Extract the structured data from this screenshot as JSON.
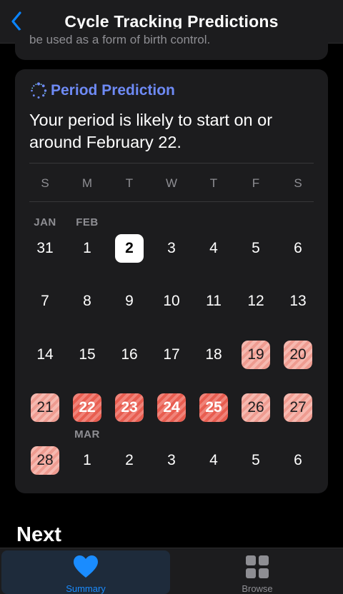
{
  "nav": {
    "title": "Cycle Tracking Predictions"
  },
  "prev_card": {
    "ghost_text": "be used as a form of birth control."
  },
  "card": {
    "label": "Period Prediction",
    "headline": "Your period is likely to start on or around February 22."
  },
  "weekdays": [
    "S",
    "M",
    "T",
    "W",
    "T",
    "F",
    "S"
  ],
  "months": {
    "jan": "JAN",
    "feb": "FEB",
    "mar": "MAR"
  },
  "weeks": [
    [
      {
        "d": "31"
      },
      {
        "d": "1"
      },
      {
        "d": "2",
        "state": "today"
      },
      {
        "d": "3"
      },
      {
        "d": "4"
      },
      {
        "d": "5"
      },
      {
        "d": "6"
      }
    ],
    [
      {
        "d": "7"
      },
      {
        "d": "8"
      },
      {
        "d": "9"
      },
      {
        "d": "10"
      },
      {
        "d": "11"
      },
      {
        "d": "12"
      },
      {
        "d": "13"
      }
    ],
    [
      {
        "d": "14"
      },
      {
        "d": "15"
      },
      {
        "d": "16"
      },
      {
        "d": "17"
      },
      {
        "d": "18"
      },
      {
        "d": "19",
        "state": "predicted"
      },
      {
        "d": "20",
        "state": "predicted"
      }
    ],
    [
      {
        "d": "21",
        "state": "predicted"
      },
      {
        "d": "22",
        "state": "predicted-high"
      },
      {
        "d": "23",
        "state": "predicted-high"
      },
      {
        "d": "24",
        "state": "predicted-high"
      },
      {
        "d": "25",
        "state": "predicted-high"
      },
      {
        "d": "26",
        "state": "predicted"
      },
      {
        "d": "27",
        "state": "predicted"
      }
    ],
    [
      {
        "d": "28",
        "state": "predicted"
      },
      {
        "d": "1"
      },
      {
        "d": "2"
      },
      {
        "d": "3"
      },
      {
        "d": "4"
      },
      {
        "d": "5"
      },
      {
        "d": "6"
      }
    ]
  ],
  "colors": {
    "accent": "#6e8af5",
    "tab_active": "#1a8cff",
    "predicted": "#ee9b90",
    "predicted_high": "#e85d50"
  },
  "section_next": "Next",
  "tabs": [
    {
      "label": "Summary",
      "icon": "heart-icon",
      "active": true
    },
    {
      "label": "Browse",
      "icon": "grid-icon",
      "active": false
    }
  ]
}
